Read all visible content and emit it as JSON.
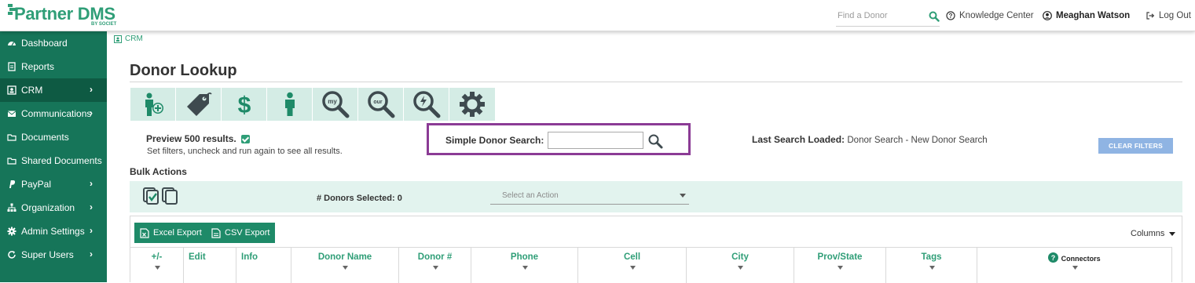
{
  "header": {
    "logo_text": "Partner DMS",
    "logo_sub": "BY SOCIET",
    "search_placeholder": "Find a Donor",
    "knowledge_center": "Knowledge Center",
    "user_name": "Meaghan Watson",
    "logout": "Log Out"
  },
  "sidebar": {
    "items": [
      {
        "label": "Dashboard",
        "icon": "dashboard-icon",
        "has_chevron": false
      },
      {
        "label": "Reports",
        "icon": "report-icon",
        "has_chevron": false
      },
      {
        "label": "CRM",
        "icon": "crm-icon",
        "has_chevron": true,
        "active": true
      },
      {
        "label": "Communications",
        "icon": "envelope-icon",
        "has_chevron": true
      },
      {
        "label": "Documents",
        "icon": "folder-icon",
        "has_chevron": false
      },
      {
        "label": "Shared Documents",
        "icon": "folder-icon",
        "has_chevron": false
      },
      {
        "label": "PayPal",
        "icon": "paypal-icon",
        "has_chevron": true
      },
      {
        "label": "Organization",
        "icon": "org-icon",
        "has_chevron": true
      },
      {
        "label": "Admin Settings",
        "icon": "gear-icon",
        "has_chevron": true
      },
      {
        "label": "Super Users",
        "icon": "refresh-icon",
        "has_chevron": true
      }
    ],
    "chevron": "›"
  },
  "breadcrumb": {
    "label": "CRM"
  },
  "page": {
    "title": "Donor Lookup"
  },
  "toolbar_icons": [
    "add-donor-icon",
    "tag-icon",
    "dollar-icon",
    "person-icon",
    "my-search-icon",
    "our-search-icon",
    "quick-search-icon",
    "settings-gear-icon"
  ],
  "filters": {
    "preview_label": "Preview 500 results.",
    "preview_checked": true,
    "preview_help": "Set filters, uncheck and run again to see all results.",
    "simple_search_label": "Simple Donor Search:",
    "simple_search_value": "",
    "last_search_label": "Last Search Loaded:",
    "last_search_value": "Donor Search - New Donor Search",
    "clear_filters": "CLEAR FILTERS"
  },
  "bulk": {
    "title": "Bulk Actions",
    "donors_selected": "# Donors Selected: 0",
    "action_placeholder": "Select an Action"
  },
  "grid": {
    "excel_export": "Excel Export",
    "csv_export": "CSV Export",
    "columns_label": "Columns",
    "headers": [
      "+/-",
      "Edit",
      "Info",
      "Donor Name",
      "Donor #",
      "Phone",
      "Cell",
      "City",
      "Prov/State",
      "Tags",
      "Connectors"
    ]
  },
  "colors": {
    "brand_green": "#2f9e77",
    "sidebar_bg": "#167559",
    "sidebar_active": "#0e5a43",
    "toolbar_tile": "#d4ece5",
    "highlight_box": "#8b3b95",
    "clear_button": "#8fb4e3"
  }
}
